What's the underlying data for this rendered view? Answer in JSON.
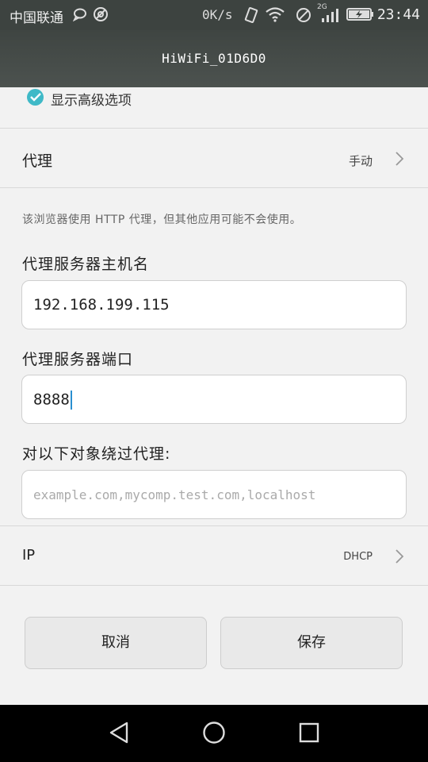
{
  "status_bar": {
    "carrier": "中国联通",
    "net_speed": "0K/s",
    "network_type": "2G",
    "time": "23:44",
    "icons": [
      "chat-bubble-icon",
      "app-notification-icon",
      "vibrate-icon",
      "wifi-icon",
      "no-sim-icon",
      "signal-icon",
      "battery-charging-icon"
    ]
  },
  "header": {
    "title": "HiWiFi_01D6D0"
  },
  "advanced": {
    "label": "显示高级选项",
    "checked": true
  },
  "proxy": {
    "label": "代理",
    "value": "手动"
  },
  "hint": "该浏览器使用 HTTP 代理，但其他应用可能不会使用。",
  "hostname": {
    "label": "代理服务器主机名",
    "value": "192.168.199.115"
  },
  "port": {
    "label": "代理服务器端口",
    "value": "8888"
  },
  "bypass": {
    "label": "对以下对象绕过代理:",
    "placeholder": "example.com,mycomp.test.com,localhost"
  },
  "ip": {
    "label": "IP",
    "value": "DHCP"
  },
  "buttons": {
    "cancel": "取消",
    "save": "保存"
  },
  "colors": {
    "accent": "#3fb9c7",
    "status_bar": "#3d4340",
    "nav_bar": "#000000"
  },
  "nav": [
    "back-icon",
    "home-icon",
    "recents-icon"
  ]
}
